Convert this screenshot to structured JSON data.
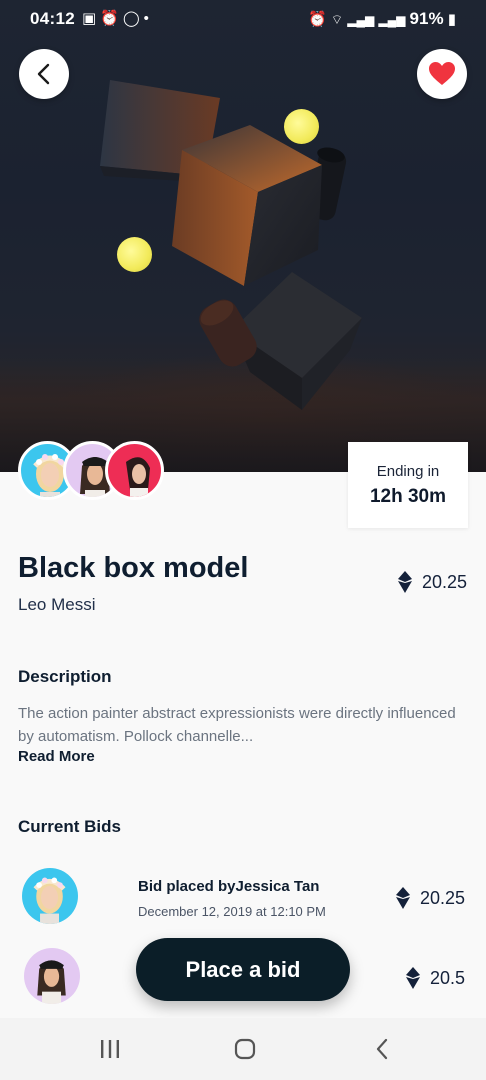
{
  "status_bar": {
    "time": "04:12",
    "battery": "91%",
    "notification_icons": [
      "image-icon",
      "alarm-icon",
      "whatsapp-icon",
      "dot-icon"
    ],
    "system_icons": [
      "alarm-icon",
      "wifi-icon",
      "signal-icon",
      "signal-icon",
      "battery-icon"
    ]
  },
  "header": {
    "back_icon": "chevron-left-icon",
    "favorite_icon": "heart-icon",
    "favorite_color": "#f0343f"
  },
  "auction": {
    "ending_label": "Ending in",
    "ending_value": "12h 30m"
  },
  "item": {
    "title": "Black box model",
    "artist": "Leo Messi",
    "price": "20.25",
    "currency_icon": "ethereum-icon"
  },
  "description": {
    "heading": "Description",
    "text": "The action painter abstract expressionists were directly influenced by automatism. Pollock channelle...",
    "read_more": "Read More"
  },
  "bids": {
    "heading": "Current Bids",
    "items": [
      {
        "by": "Bid placed byJessica Tan",
        "date": "December 12, 2019 at 12:10 PM",
        "price": "20.25"
      },
      {
        "price": "20.5"
      }
    ]
  },
  "cta": {
    "label": "Place a bid"
  },
  "colors": {
    "primary_dark": "#0b1e28",
    "text_dark": "#0f1e30",
    "muted": "#6b7480",
    "avatar_bg_1": "#3cc6ee",
    "avatar_bg_2": "#e3c9f2",
    "avatar_bg_3": "#ee2d55"
  }
}
